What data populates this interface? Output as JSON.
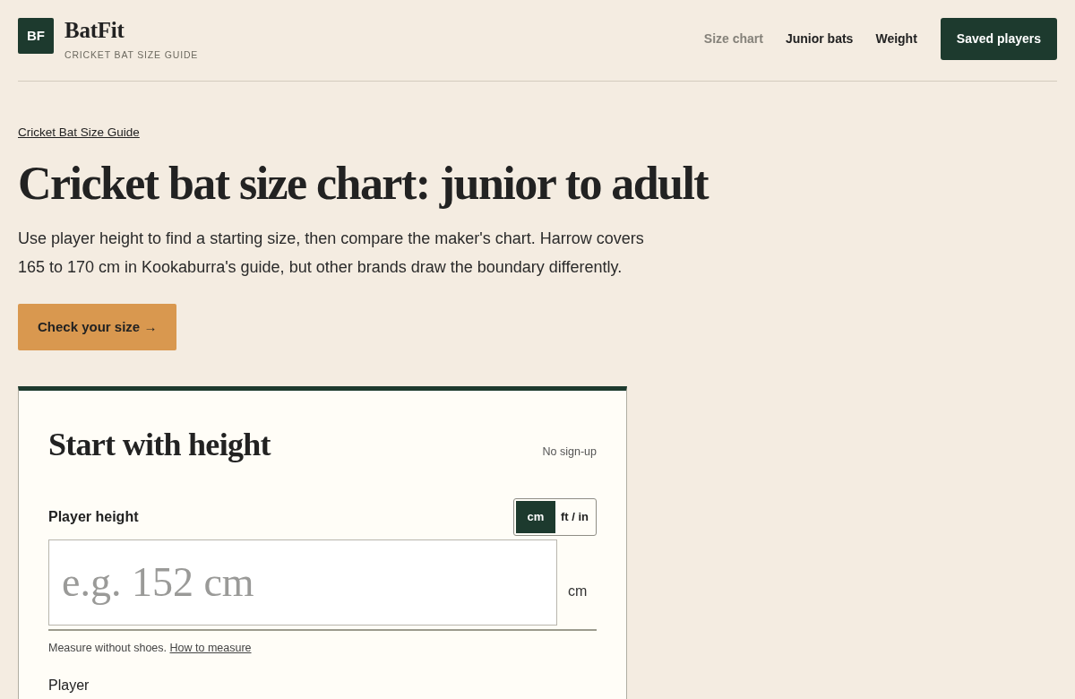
{
  "header": {
    "logo": "BF",
    "title": "BatFit",
    "subtitle": "CRICKET BAT SIZE GUIDE",
    "nav": [
      {
        "label": "Size chart",
        "selected": true
      },
      {
        "label": "Junior bats",
        "selected": false
      },
      {
        "label": "Weight",
        "selected": false
      }
    ],
    "action_button": "Saved players"
  },
  "breadcrumb": "Cricket Bat Size Guide",
  "heading": "Cricket bat size chart: junior to adult",
  "intro": "Use player height to find a starting size, then compare the maker's chart. Harrow covers 165 to 170 cm in Kookaburra's guide, but other brands draw the boundary differently.",
  "cta_button": "Check your size →",
  "card": {
    "title": "Start with height",
    "note": "No sign-up",
    "field": {
      "label": "Player height",
      "units": [
        {
          "label": "cm",
          "selected": true
        },
        {
          "label": "ft / in",
          "selected": false
        }
      ],
      "placeholder": "e.g. 152 cm",
      "unit_suffix": "cm",
      "help": "Measure without shoes.",
      "help_link": "How to measure"
    },
    "next_label": "Player"
  }
}
